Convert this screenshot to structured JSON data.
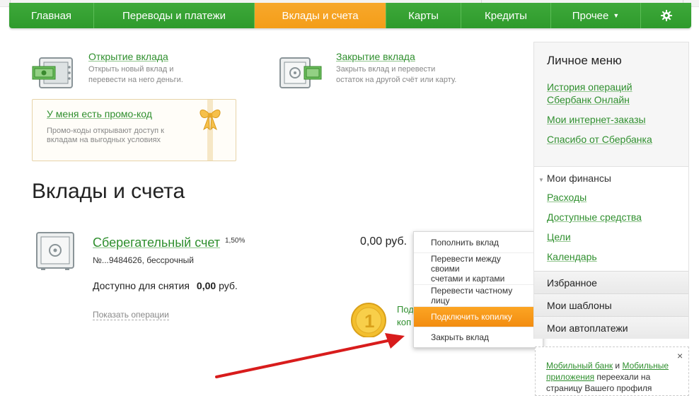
{
  "nav": {
    "items": [
      {
        "label": "Главная"
      },
      {
        "label": "Переводы и платежи"
      },
      {
        "label": "Вклады и счета"
      },
      {
        "label": "Карты"
      },
      {
        "label": "Кредиты"
      },
      {
        "label": "Прочее"
      }
    ],
    "active_index": 2,
    "gear_icon": "gear-icon"
  },
  "tiles": {
    "open": {
      "title": "Открытие вклада",
      "desc1": "Открыть новый вклад и",
      "desc2": "перевести на него деньги."
    },
    "close": {
      "title": "Закрытие вклада",
      "desc1": "Закрыть вклад и перевести",
      "desc2": "остаток на другой счёт или карту."
    },
    "promo": {
      "title": "У меня есть промо-код",
      "desc1": "Промо-коды открывают доступ к",
      "desc2": "вкладам на выгодных условиях"
    }
  },
  "page_title": "Вклады и счета",
  "account": {
    "name": "Сберегательный счет",
    "rate": "1,50%",
    "number": "№...9484626, бессрочный",
    "available_label": "Доступно для снятия",
    "available_amount": "0,00",
    "available_currency": "руб.",
    "balance": "0,00 руб.",
    "show_ops": "Показать операции",
    "kopilka_line1": "Под",
    "kopilka_line2": "коп"
  },
  "dropdown": {
    "options": [
      {
        "line1": "Пополнить вклад",
        "line2": ""
      },
      {
        "line1": "Перевести между своими",
        "line2": "счетами и картами"
      },
      {
        "line1": "Перевести частному лицу",
        "line2": ""
      },
      {
        "line1": "Подключить копилку",
        "line2": ""
      },
      {
        "line1": "Закрыть вклад",
        "line2": ""
      }
    ],
    "highlighted_index": 3
  },
  "sidebar": {
    "heading": "Личное меню",
    "links": [
      "История операций",
      "Сбербанк Онлайн",
      "Мои интернет-заказы",
      "Спасибо от Сбербанка"
    ],
    "finances_heading": "Мои финансы",
    "finances_links": [
      "Расходы",
      "Доступные средства",
      "Цели",
      "Календарь"
    ],
    "rows": [
      "Избранное",
      "Мои шаблоны",
      "Мои автоплатежи"
    ]
  },
  "notice": {
    "link1": "Мобильный банк",
    "and": " и ",
    "link2": "Мобильные приложения",
    "rest": " переехали на страницу Вашего профиля",
    "close": "×"
  },
  "colors": {
    "nav_green": "#2e9a2c",
    "active_orange": "#f49d18",
    "link_green": "#2f8f2e"
  }
}
